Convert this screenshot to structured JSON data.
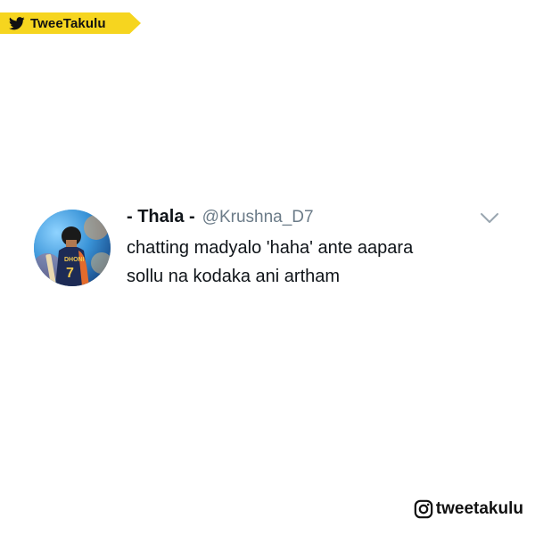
{
  "brand": {
    "name": "TweeTakulu",
    "icon": "twitter-bird-icon",
    "tag_color": "#f6d51f"
  },
  "tweet": {
    "display_name": "- Thala -",
    "handle": "@Krushna_D7",
    "text_lines": [
      "chatting madyalo 'haha' ante aapara",
      "sollu na kodaka ani artham"
    ],
    "avatar_icon": "profile-avatar",
    "menu_icon": "chevron-down-icon"
  },
  "footer": {
    "instagram_handle": "tweetakulu",
    "icon": "instagram-icon"
  }
}
